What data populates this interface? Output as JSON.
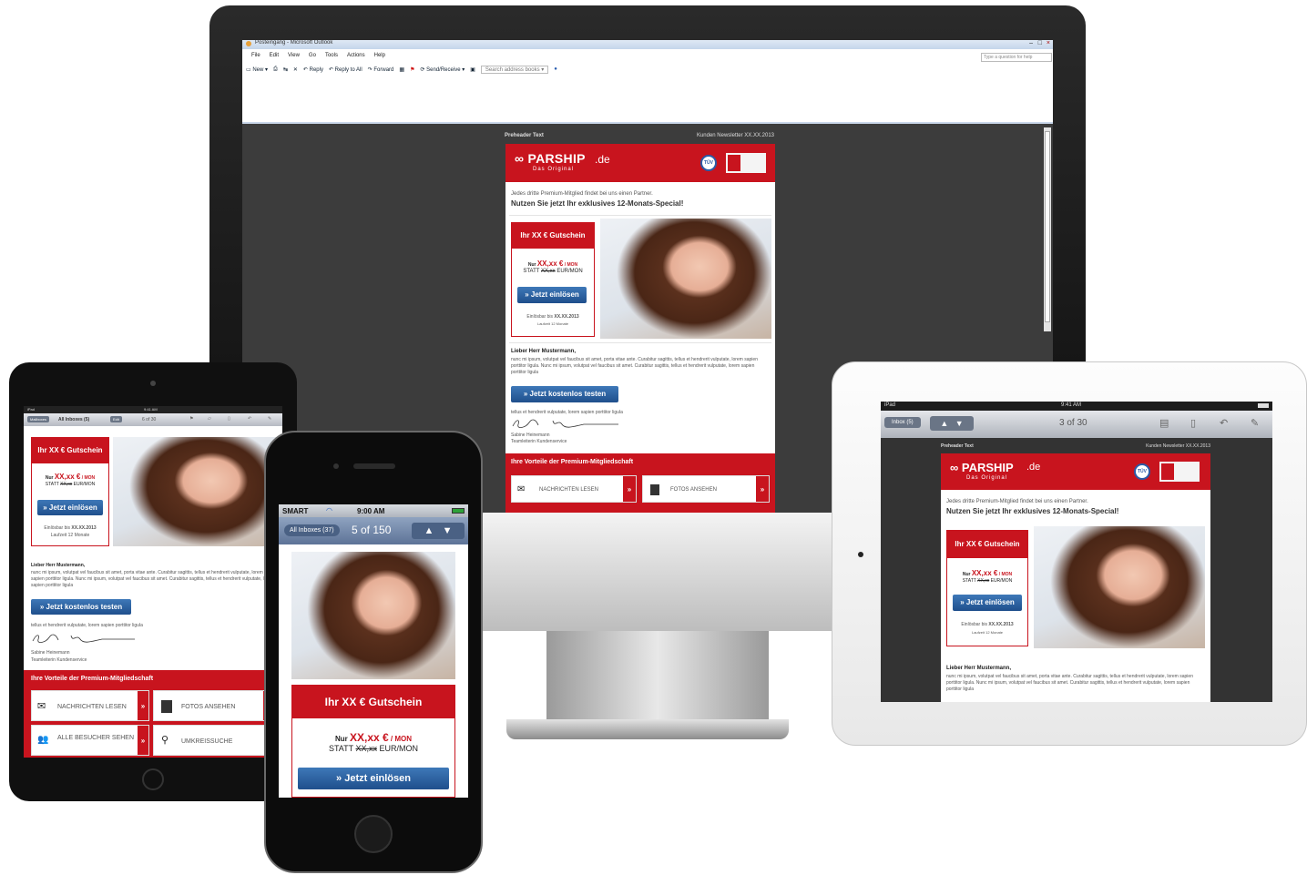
{
  "outlook": {
    "title": "Posteingang - Microsoft Outlook",
    "menu": [
      "File",
      "Edit",
      "View",
      "Go",
      "Tools",
      "Actions",
      "Help"
    ],
    "toolbar": {
      "new": "New",
      "reply": "Reply",
      "reply_all": "Reply to All",
      "forward": "Forward",
      "send_receive": "Send/Receive",
      "address_search_placeholder": "Search address books"
    },
    "help_placeholder": "Type a question for help"
  },
  "newsletter": {
    "preheader": "Preheader Text",
    "edition": "Kunden Newsletter XX.XX.2013",
    "brand": "PARSHIP",
    "brand_tld": ".de",
    "tagline": "Das Original",
    "tuv_label": "TÜV",
    "intro": "Jedes dritte Premium-Mitglied findet bei uns einen Partner.",
    "headline": "Nutzen Sie jetzt Ihr exklusives 12-Monats-Special!",
    "voucher": {
      "title": "Ihr XX € Gutschein",
      "price_prefix": "Nur",
      "price": "XX,xx €",
      "price_unit": "/ MON",
      "strike_prefix": "STATT",
      "strike": "XX,xx",
      "strike_suffix": "EUR/MON",
      "button": "» Jetzt einlösen",
      "valid_prefix": "Einlösbar bis",
      "valid_date": "XX.XX.2013",
      "duration": "Laufzeit 12 Monate"
    },
    "salutation": "Lieber Herr Mustermann,",
    "body": "nunc mi ipsum, volutpat vel faucibus sit amet, porta vitae ante. Curabitur sagittis, tellus et hendrerit vulputate, lorem sapien porttitor ligula. Nunc mi ipsum, volutpat vel faucibus sit amet. Curabitur sagittis, tellus et hendrerit vulputate, lorem sapien porttitor ligula",
    "cta": "» Jetzt kostenlos testen",
    "closing": "tellus et hendrerit vulputate, lorem sapien porttitor ligula",
    "signature_name": "Sabine Heinemann",
    "signature_role": "Teamleiterin Kundenservice",
    "benefits_title": "Ihre Vorteile der Premium-Mitgliedschaft",
    "benefits": [
      "NACHRICHTEN LESEN",
      "FOTOS ANSEHEN",
      "ALLE BESUCHER SEHEN",
      "UMKREISSUCHE"
    ]
  },
  "ipad_left": {
    "status_left": "iPad",
    "status_time": "9:41 AM",
    "back": "Mailboxes",
    "inbox": "All Inboxes (5)",
    "edit": "Edit",
    "counter": "6 of 30"
  },
  "iphone": {
    "carrier": "SMART",
    "time": "9:00 AM",
    "inbox": "All Inboxes (37)",
    "counter": "5 of 150"
  },
  "ipad_right": {
    "status_left": "iPad",
    "status_time": "9:41 AM",
    "inbox": "Inbox (5)",
    "counter": "3 of 30"
  },
  "colors": {
    "brand_red": "#c8141e",
    "button_blue": "#1f4f8c"
  }
}
